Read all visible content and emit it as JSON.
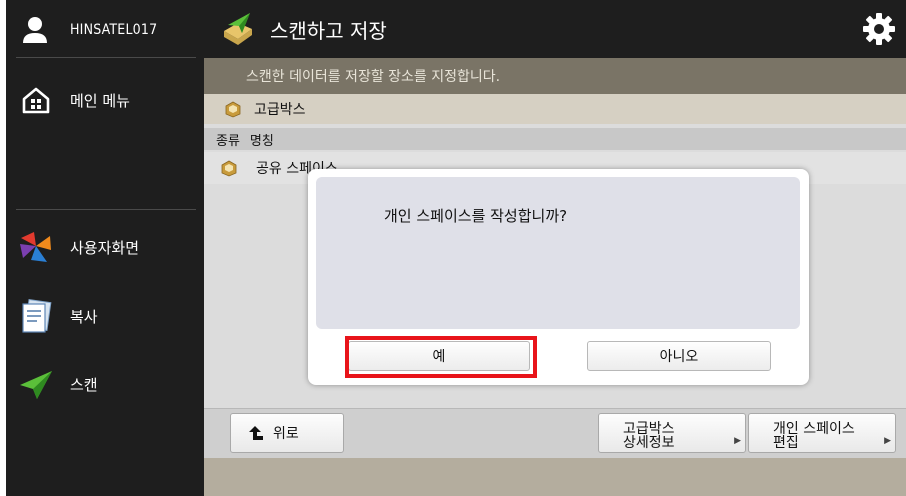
{
  "sidebar": {
    "username": "HINSATEL017",
    "main_menu": "메인 메뉴",
    "items": [
      {
        "label": "사용자화면",
        "icon": "user-screen-icon"
      },
      {
        "label": "복사",
        "icon": "copy-icon"
      },
      {
        "label": "스캔",
        "icon": "scan-icon"
      }
    ]
  },
  "header": {
    "title": "스캔하고 저장",
    "settings_icon": "gear-icon"
  },
  "instruction": "스캔한 데이터를 저장할 장소를 지정합니다.",
  "location": "고급박스",
  "columns": [
    "종류",
    "명칭"
  ],
  "list": [
    {
      "name": "공유 스페이스"
    }
  ],
  "toolbar": {
    "up_label": "위로",
    "detail_line1": "고급박스",
    "detail_line2": "상세정보",
    "edit_line1": "개인 스페이스",
    "edit_line2": "편집"
  },
  "dialog": {
    "message": "개인 스페이스를 작성합니까?",
    "yes_label": "예",
    "no_label": "아니오"
  },
  "colors": {
    "highlight": "#e8141a",
    "sidebar_bg": "#1e1e1e",
    "instruction_bg": "#7a7466"
  }
}
